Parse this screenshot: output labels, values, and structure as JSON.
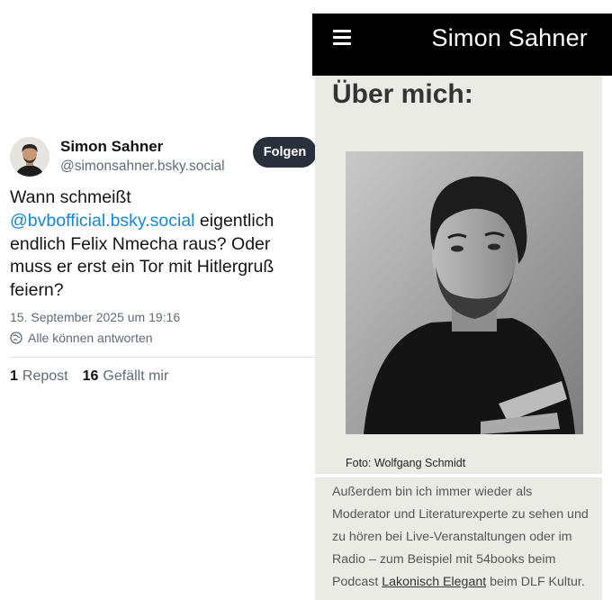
{
  "post": {
    "author": {
      "name": "Simon Sahner",
      "handle": "@simonsahner.bsky.social"
    },
    "follow_label": "Folgen",
    "text_lines": {
      "l1": "Wann schmeißt",
      "mention": "@bvbofficial.bsky.social",
      "l2_rest": " eigentlich",
      "l3": "endlich Felix Nmecha raus? Oder",
      "l4": "muss er erst ein Tor mit Hitlergruß",
      "l5": "feiern?"
    },
    "date": "15. September 2025 um 19:16",
    "reply_setting": "Alle können antworten",
    "stats": {
      "reposts_count": "1",
      "reposts_label": "Repost",
      "likes_count": "16",
      "likes_label": "Gefällt mir"
    },
    "colors": {
      "mention": "#1786d8",
      "follow_button": "#27303b"
    }
  },
  "site": {
    "title": "Simon Sahner",
    "heading": "Über mich:",
    "photo_caption": "Foto: Wolfgang Schmidt",
    "bio": {
      "l1": "Außerdem bin ich immer wieder als",
      "l2": "Moderator und Literaturexperte zu sehen und",
      "l3": "zu hören bei Live-Veranstaltungen oder im",
      "l4": "Radio – zum Beispiel mit 54books beim",
      "l5_pre": "Podcast ",
      "link": "Lakonisch Elegant",
      "l5_post": " beim DLF Kultur."
    },
    "colors": {
      "header": "#000000",
      "content_bg": "#ebebe6"
    }
  },
  "icons": [
    "avatar",
    "menu-icon",
    "reply-setting-icon",
    "portrait-photo"
  ]
}
